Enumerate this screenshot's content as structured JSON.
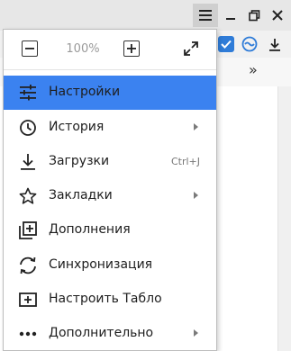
{
  "zoom": {
    "value": "100%"
  },
  "menu": {
    "items": [
      {
        "label": "Настройки",
        "icon": "settings-sliders-icon"
      },
      {
        "label": "История",
        "icon": "clock-icon",
        "submenu": true
      },
      {
        "label": "Загрузки",
        "icon": "download-icon",
        "shortcut": "Ctrl+J"
      },
      {
        "label": "Закладки",
        "icon": "star-icon",
        "submenu": true
      },
      {
        "label": "Дополнения",
        "icon": "extensions-icon"
      },
      {
        "label": "Синхронизация",
        "icon": "sync-icon"
      },
      {
        "label": "Настроить Табло",
        "icon": "add-tile-icon"
      },
      {
        "label": "Дополнительно",
        "icon": "more-dots-icon",
        "submenu": true
      }
    ]
  },
  "toolbar": {
    "more_chevron": "»"
  },
  "colors": {
    "highlight": "#3b82f0",
    "accent_check": "#2f7cd8",
    "sync_blue": "#2f7cd8"
  }
}
